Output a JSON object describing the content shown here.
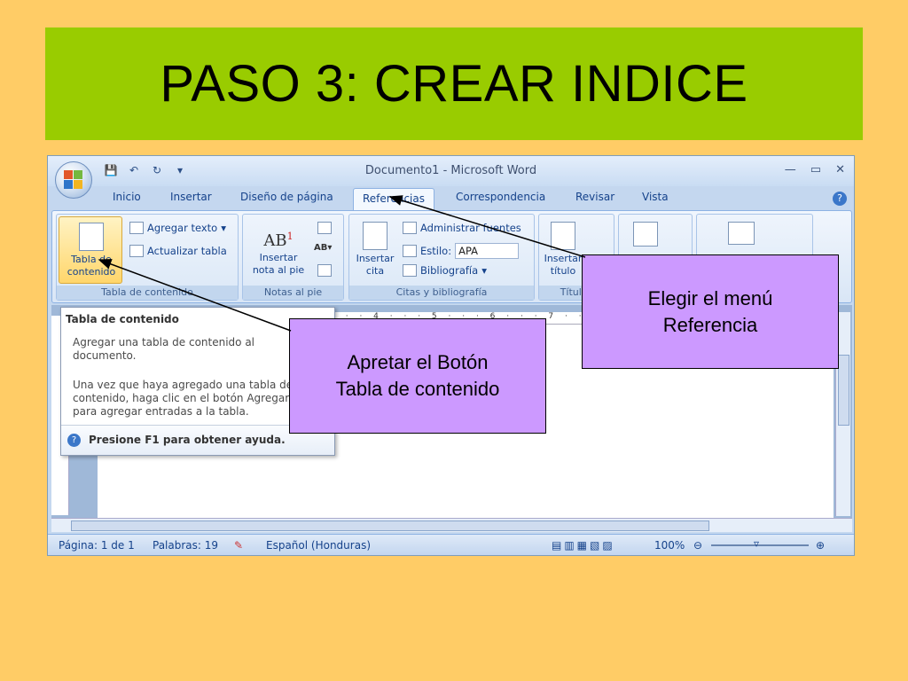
{
  "slide": {
    "title": "PASO 3: CREAR INDICE"
  },
  "window": {
    "title": "Documento1  -  Microsoft Word"
  },
  "tabs": [
    "Inicio",
    "Insertar",
    "Diseño de página",
    "Referencias",
    "Correspondencia",
    "Revisar",
    "Vista"
  ],
  "active_tab": "Referencias",
  "ribbon": {
    "tabla_contenido": {
      "button_line1": "Tabla de",
      "button_line2": "contenido",
      "agregar_texto": "Agregar texto",
      "actualizar_tabla": "Actualizar tabla",
      "group_label": "Tabla de contenido"
    },
    "notas": {
      "insertar_nota_line1": "Insertar",
      "insertar_nota_line2": "nota al pie",
      "group_label": "Notas al pie"
    },
    "citas": {
      "insertar_cita_line1": "Insertar",
      "insertar_cita_line2": "cita",
      "administrar_fuentes": "Administrar fuentes",
      "estilo_label": "Estilo:",
      "estilo_value": "APA",
      "bibliografia": "Bibliografía",
      "group_label": "Citas y bibliografía"
    },
    "titulos": {
      "insertar_titulo_line1": "Insertar",
      "insertar_titulo_line2": "título",
      "group_label": "Títulos"
    }
  },
  "tooltip": {
    "title": "Tabla de contenido",
    "paragraph1": "Agregar una tabla de contenido al documento.",
    "paragraph2": "Una vez que haya agregado una tabla de contenido, haga clic en el botón Agregar para agregar entradas a la tabla.",
    "footer": "Presione F1 para obtener ayuda."
  },
  "ruler": {
    "text": "· · · 4 · · · 5 · · · 6 · · · 7 · · · 8 · · · 9 ·"
  },
  "statusbar": {
    "pagina": "Página: 1 de 1",
    "palabras": "Palabras: 19",
    "idioma": "Español (Honduras)",
    "zoom": "100%"
  },
  "annotations": {
    "callout_menu_line1": "Elegir el menú",
    "callout_menu_line2": "Referencia",
    "callout_button_line1": "Apretar el Botón",
    "callout_button_line2": "Tabla de contenido"
  },
  "colors": {
    "background": "#ffcc66",
    "title_banner": "#99cc00",
    "callout_fill": "#cc99ff"
  }
}
